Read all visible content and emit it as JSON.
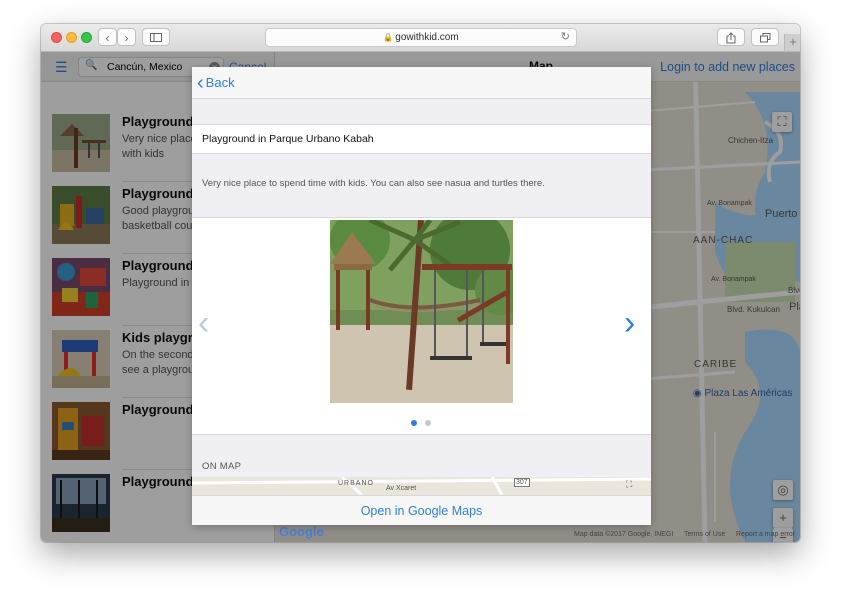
{
  "browser": {
    "url": "gowithkid.com",
    "back_glyph": "‹",
    "forward_glyph": "›",
    "icons": [
      "sidebar-icon",
      "share-icon",
      "tabs-icon",
      "lock-icon",
      "reload-icon",
      "new-tab-icon"
    ]
  },
  "sidebar": {
    "search_value": "Cancún, Mexico",
    "cancel_label": "Cancel",
    "items": [
      {
        "title": "Playground in",
        "desc": "Very nice place to spend time with kids"
      },
      {
        "title": "Playground in",
        "desc": "Good playground with a basketball court in a Park"
      },
      {
        "title": "Playground in",
        "desc": "Playground in"
      },
      {
        "title": "Kids playground",
        "desc": "On the second floor you can see a playground in"
      },
      {
        "title": "Playground in",
        "desc": ""
      },
      {
        "title": "Playground in",
        "desc": ""
      }
    ]
  },
  "map": {
    "title": "Map",
    "login_label": "Login to add new places",
    "labels": {
      "chichen_itza": "Chichen-Itza",
      "puerto_cancun": "Puerto Cancun",
      "av_bonampak": "Av. Bonampak",
      "aan_chac": "AAN-CHAC",
      "av_bonampak_2": "Av. Bonampak",
      "blvd_kukulcan": "Blvd. Kukulcan",
      "playa": "Playa",
      "blvd": "Blvd",
      "caribe": "CARIBE",
      "plaza": "Plaza Las Américas"
    },
    "zoom_in": "+",
    "zoom_out": "−",
    "google": "Google",
    "attribution": {
      "data": "Map data ©2017 Google, INEGI",
      "terms": "Terms of Use",
      "report": "Report a map error"
    }
  },
  "modal": {
    "back_label": "Back",
    "place_name": "Playground in Parque Urbano Kabah",
    "description": "Very nice place to spend time with kids. You can also see nasua and turtles there.",
    "gallery": {
      "current_index": 1,
      "total": 2
    },
    "on_map_label": "ON MAP",
    "mini_map_labels": {
      "urbano": "URBANO",
      "xcaret": "Av Xcaret",
      "route": "307"
    },
    "open_maps_label": "Open in Google Maps"
  },
  "colors": {
    "accent": "#2f7fd8",
    "dot_active": "#2f7fd8",
    "dot_inactive": "#c7c7cc"
  }
}
